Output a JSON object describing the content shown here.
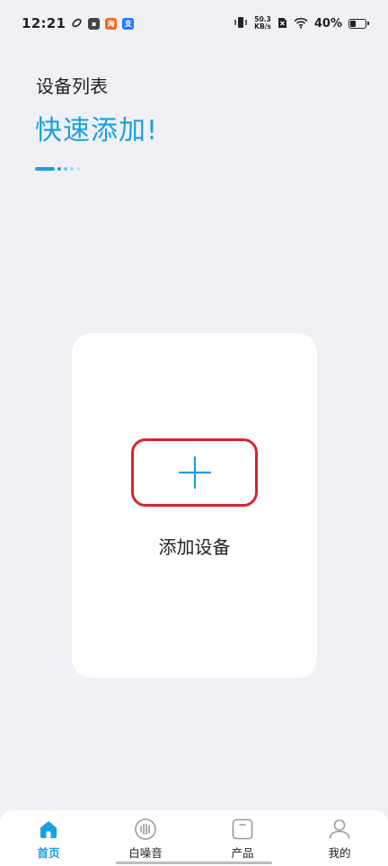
{
  "status_bar": {
    "time": "12:21",
    "net_speed_value": "50.3",
    "net_speed_unit": "KB/s",
    "battery_percent": "40%",
    "notification_icons": [
      "link-icon",
      "app-icon",
      "taobao-icon",
      "alipay-icon"
    ]
  },
  "header": {
    "subtitle": "设备列表",
    "title": "快速添加!"
  },
  "pager": {
    "count": 5,
    "active_index": 0
  },
  "device_card": {
    "add_label": "添加设备"
  },
  "bottom_nav": {
    "items": [
      {
        "label": "首页",
        "icon": "home-icon",
        "active": true
      },
      {
        "label": "白噪音",
        "icon": "white-noise-icon",
        "active": false
      },
      {
        "label": "产品",
        "icon": "product-icon",
        "active": false
      },
      {
        "label": "我的",
        "icon": "profile-icon",
        "active": false
      }
    ]
  },
  "colors": {
    "accent": "#1aa0e0",
    "highlight_border": "#d7252e",
    "background": "#f0f1f5",
    "card": "#ffffff"
  }
}
